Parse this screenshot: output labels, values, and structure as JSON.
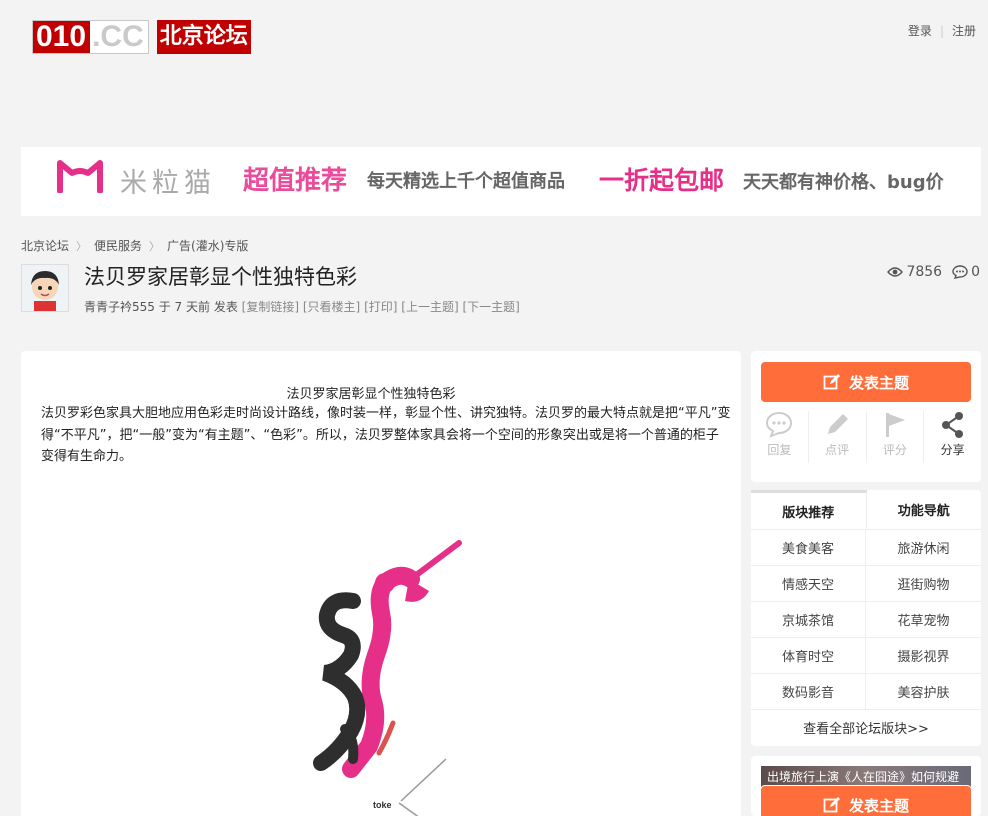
{
  "header": {
    "logo_number": "010",
    "logo_domain": ".CC",
    "logo_name": "北京论坛",
    "login": "登录",
    "register": "注册"
  },
  "banner": {
    "brand": "米粒猫",
    "headline1": "超值推荐",
    "sub1": "每天精选上千个超值商品",
    "headline2": "一折起包邮",
    "sub2": "天天都有神价格、bug价",
    "accent": "#e62f89"
  },
  "breadcrumb": [
    "北京论坛",
    "便民服务",
    "广告(灌水)专版"
  ],
  "thread": {
    "title": "法贝罗家居彰显个性独特色彩",
    "author": "青青子衿555",
    "time": "于 7 天前 发表",
    "actions": [
      "[复制链接]",
      "[只看楼主]",
      "[打印]",
      "[上一主题]",
      "[下一主题]"
    ],
    "views": "7856",
    "replies": "0"
  },
  "post": {
    "heading": "法贝罗家居彰显个性独特色彩",
    "body": "法贝罗彩色家具大胆地应用色彩走时尚设计路线，像时装一样，彰显个性、讲究独特。法贝罗的最大特点就是把“平凡”变得“不平凡”，把“一般”变为“有主题”、“色彩”。所以，法贝罗整体家具会将一个空间的形象突出或是将一个普通的柜子变得有生命力。",
    "image_caption": "toke"
  },
  "sidebar": {
    "post_button": "发表主题",
    "actions": {
      "reply": "回复",
      "comment": "点评",
      "rate": "评分",
      "share": "分享"
    },
    "tabs": [
      "版块推荐",
      "功能导航"
    ],
    "forums": [
      "美食美客",
      "旅游休闲",
      "情感天空",
      "逛街购物",
      "京城茶馆",
      "花草宠物",
      "体育时空",
      "摄影视界",
      "数码影音",
      "美容护肤"
    ],
    "more": "查看全部论坛版块>>",
    "promo_text": "出境旅行上演《人在囧途》如何规避",
    "accent": "#ff6d3a"
  }
}
